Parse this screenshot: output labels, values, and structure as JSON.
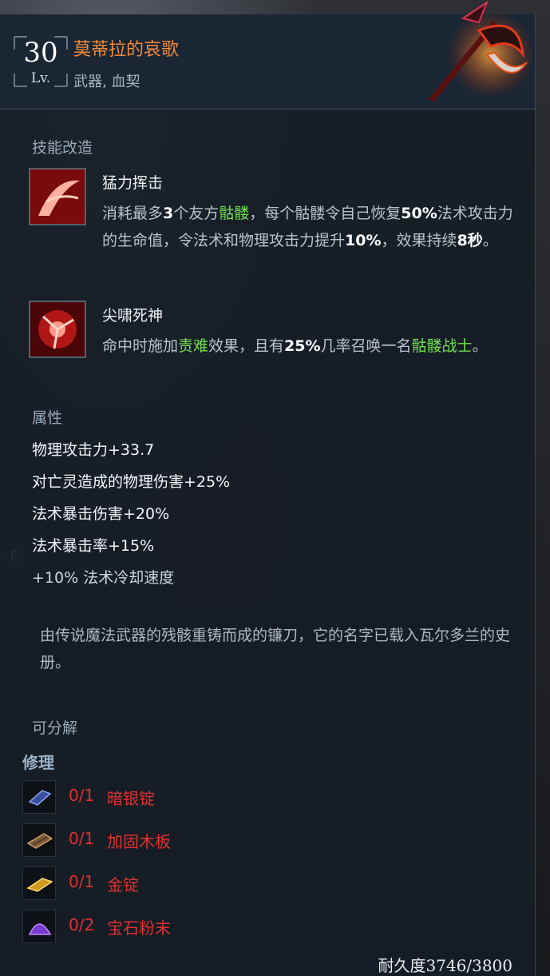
{
  "item": {
    "level": "30",
    "level_label": "Lv.",
    "name": "莫蒂拉的哀歌",
    "type": "武器, 血契",
    "icon": "scythe-weapon-icon"
  },
  "skills_section_title": "技能改造",
  "skills": [
    {
      "icon": "slash-skill-icon",
      "name": "猛力挥击",
      "desc": [
        {
          "t": "消耗最多",
          "s": ""
        },
        {
          "t": "3",
          "s": "hl"
        },
        {
          "t": "个友方",
          "s": ""
        },
        {
          "t": "骷髅",
          "s": "gr"
        },
        {
          "t": "，每个骷髅令自己恢复",
          "s": ""
        },
        {
          "t": "50%",
          "s": "hl"
        },
        {
          "t": "法术攻击力的生命值，令法术和物理攻击力提升",
          "s": ""
        },
        {
          "t": "10%",
          "s": "hl"
        },
        {
          "t": "，效果持续",
          "s": ""
        },
        {
          "t": "8秒",
          "s": "hl"
        },
        {
          "t": "。",
          "s": ""
        }
      ]
    },
    {
      "icon": "reaper-skill-icon",
      "name": "尖啸死神",
      "desc": [
        {
          "t": "命中时施加",
          "s": ""
        },
        {
          "t": "责难",
          "s": "gr"
        },
        {
          "t": "效果，且有",
          "s": ""
        },
        {
          "t": "25%",
          "s": "hl"
        },
        {
          "t": "几率召唤一名",
          "s": ""
        },
        {
          "t": "骷髅战士",
          "s": "gr"
        },
        {
          "t": "。",
          "s": ""
        }
      ]
    }
  ],
  "attributes_title": "属性",
  "attributes": [
    "物理攻击力+33.7",
    "对亡灵造成的物理伤害+25%",
    "法术暴击伤害+20%",
    "法术暴击率+15%",
    "+10% 法术冷却速度"
  ],
  "lore": "由传说魔法武器的残骸重铸而成的镰刀，它的名字已载入瓦尔多兰的史册。",
  "salvage_label": "可分解",
  "repair_title": "修理",
  "materials": [
    {
      "icon": "dark-silver-ingot-icon",
      "count": "0/1",
      "name": "暗银锭"
    },
    {
      "icon": "reinforced-plank-icon",
      "count": "0/1",
      "name": "加固木板"
    },
    {
      "icon": "gold-ingot-icon",
      "count": "0/1",
      "name": "金锭"
    },
    {
      "icon": "gem-powder-icon",
      "count": "0/2",
      "name": "宝石粉末"
    }
  ],
  "durability": "耐久度3746/3800",
  "hotkey": "F",
  "colors": {
    "name": "#f28a3a",
    "highlight_green": "#6fe04e",
    "missing": "#e03131"
  }
}
